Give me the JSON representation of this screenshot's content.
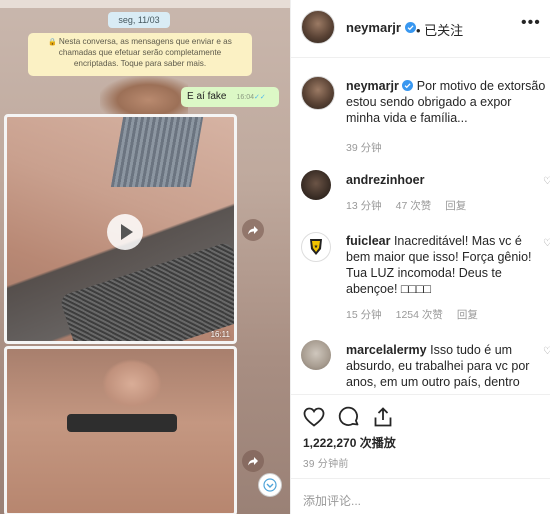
{
  "whatsapp": {
    "date_label": "seg, 11/03",
    "encryption_notice": "Nesta conversa, as mensagens que enviar e as chamadas que efetuar serão completamente encriptadas. Toque para saber mais.",
    "bubble_text": "E aí fake",
    "bubble_time": "16:04",
    "video1_duration": "16:11"
  },
  "header": {
    "username": "neymarjr",
    "follow_label": "• 已关注",
    "more_label": "•••"
  },
  "caption": {
    "username": "neymarjr",
    "text": "Por motivo de extorsão estou sendo obrigado a expor minha vida e família...",
    "time": "39 分钟"
  },
  "comments": [
    {
      "username": "andrezinhoer",
      "text": "",
      "time": "13 分钟",
      "likes": "47 次赞",
      "reply": "回复"
    },
    {
      "username": "fuiclear",
      "text": "Inacreditável! Mas vc é bem maior que isso! Força gênio! Tua LUZ incomoda! Deus te abençoe! □□□□",
      "time": "15 分钟",
      "likes": "1254 次赞",
      "reply": "回复"
    },
    {
      "username": "marcelalermy",
      "text": "Isso tudo é um absurdo, eu trabalhei para vc por anos, em um outro país, dentro"
    }
  ],
  "actions": {
    "views": "1,222,270 次播放",
    "posted_ago": "39 分钟前",
    "add_comment_placeholder": "添加评论..."
  },
  "icons": {
    "verified_color": "#3897f0",
    "like": "heart-icon",
    "comment": "comment-icon",
    "share": "share-icon"
  }
}
